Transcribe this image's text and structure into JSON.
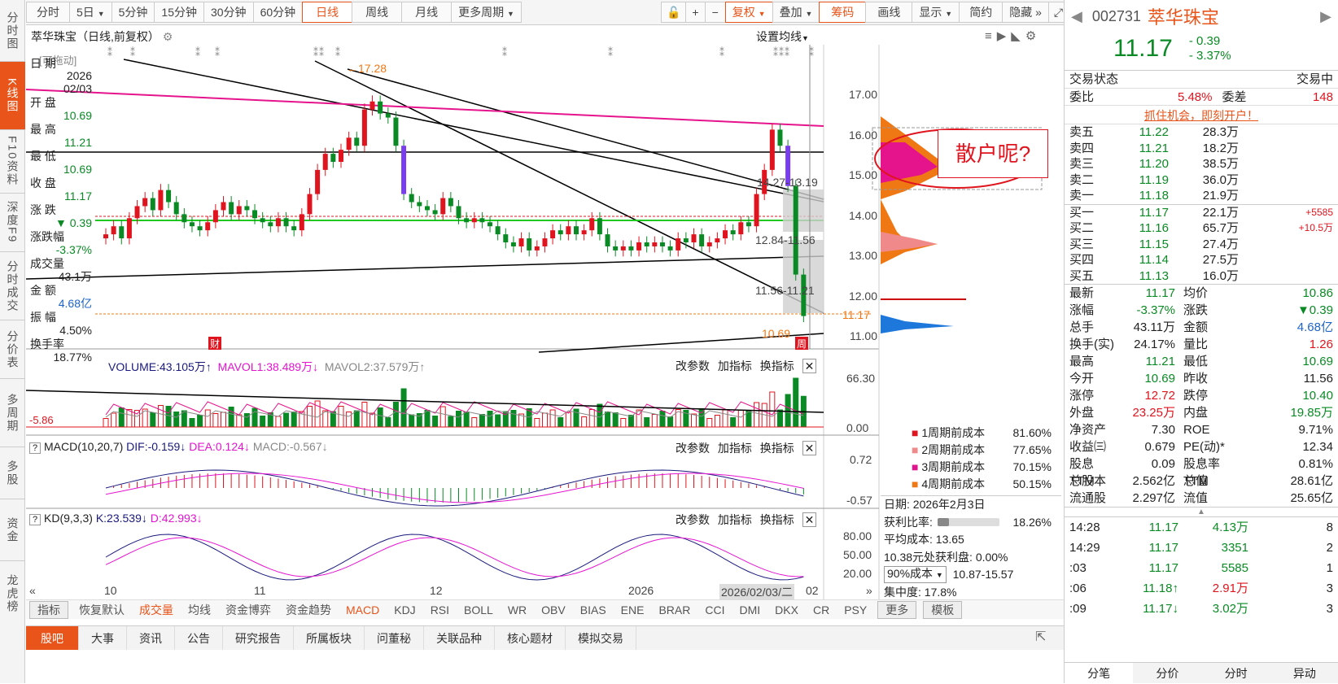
{
  "leftnav": [
    "分时图",
    "K线图",
    "F10资料",
    "深度F9",
    "分时成交",
    "分价表",
    "多周期",
    "多股",
    "资金",
    "龙虎榜"
  ],
  "toolbar": {
    "periods": [
      "分时",
      "5日",
      "5分钟",
      "15分钟",
      "30分钟",
      "60分钟",
      "日线",
      "周线",
      "月线",
      "更多周期"
    ],
    "active": "日线",
    "right": [
      "复权",
      "叠加",
      "筹码",
      "画线",
      "显示",
      "简约",
      "隐藏"
    ]
  },
  "chart_title": "萃华珠宝（日线,前复权）",
  "set_ma": "设置均线",
  "draggable": "[可拖动]",
  "info": {
    "date_label": "日 期",
    "date_year": "2026",
    "date_md": "02/03",
    "open_label": "开 盘",
    "open": "10.69",
    "high_label": "最 高",
    "high": "11.21",
    "low_label": "最 低",
    "low": "10.69",
    "close_label": "收 盘",
    "close": "11.17",
    "chg_label": "涨 跌",
    "chg": "▼ 0.39",
    "chgp_label": "涨跌幅",
    "chgp": "-3.37%",
    "vol_label": "成交量",
    "vol": "43.1万",
    "amt_label": "金 额",
    "amt": "4.68亿",
    "amp_label": "振 幅",
    "amp": "4.50%",
    "turn_label": "换手率",
    "turn": "18.77%"
  },
  "price_axis": [
    "17.00",
    "16.00",
    "15.00",
    "14.00",
    "13.00",
    "12.00",
    "11.00"
  ],
  "last_price_tag": "11.17",
  "annotations": {
    "high": "←17.28",
    "a1": "14.27-13.19",
    "a2": "12.84-11.56",
    "a3": "11.56-11.21",
    "a4": "10.69",
    "speech": "散户呢?",
    "low_tag": "-5.86"
  },
  "volume": {
    "label": "VOLUME:43.105万",
    "mavol1": "MAVOL1:38.489万",
    "mavol2": "MAVOL2:37.579万",
    "axis_top": "66.30",
    "axis_bot": "0.00"
  },
  "macd": {
    "label": "MACD(10,20,7)",
    "dif": "DIF:-0.159",
    "dea": "DEA:0.124",
    "macd": "MACD:-0.567",
    "axis_top": "0.72",
    "axis_bot": "-0.57"
  },
  "kd": {
    "label": "KD(9,3,3)",
    "k": "K:23.539",
    "d": "D:42.993",
    "axis": [
      "80.00",
      "50.00",
      "20.00"
    ]
  },
  "panel_btns": [
    "改参数",
    "加指标",
    "换指标"
  ],
  "x_axis": [
    "10",
    "11",
    "12",
    "2026"
  ],
  "x_cursor": "2026/02/03/二",
  "x_end": "02",
  "chip": {
    "legend": [
      {
        "n": "1周期前成本",
        "v": "81.60%",
        "c": "#e0141e"
      },
      {
        "n": "2周期前成本",
        "v": "77.65%",
        "c": "#f08a8a"
      },
      {
        "n": "3周期前成本",
        "v": "70.15%",
        "c": "#e0148c"
      },
      {
        "n": "4周期前成本",
        "v": "50.15%",
        "c": "#f07814"
      }
    ],
    "date": "日期: 2026年2月3日",
    "profit_label": "获利比率:",
    "profit_ratio": 0.1826,
    "profit": "18.26%",
    "avg": "平均成本: 13.65",
    "profit_at": "10.38元处获利盘: 0.00%",
    "cost_sel": "90%成本",
    "cost_range": "10.87-15.57",
    "conc": "集中度: 17.8%"
  },
  "indicators": [
    "指标",
    "恢复默认",
    "成交量",
    "均线",
    "资金博弈",
    "资金趋势",
    "MACD",
    "KDJ",
    "RSI",
    "BOLL",
    "WR",
    "OBV",
    "BIAS",
    "ENE",
    "BRAR",
    "CCI",
    "DMI",
    "DKX",
    "CR",
    "PSY",
    "更多",
    "模板"
  ],
  "bottom_tabs": [
    "股吧",
    "大事",
    "资讯",
    "公告",
    "研究报告",
    "所属板块",
    "问董秘",
    "关联品种",
    "核心题材",
    "模拟交易"
  ],
  "quote": {
    "code": "002731",
    "name": "萃华珠宝",
    "price": "11.17",
    "chg": "- 0.39",
    "chgp": "- 3.37%",
    "status_label": "交易状态",
    "status": "交易中",
    "wb_label": "委比",
    "wb": "5.48%",
    "wc_label": "委差",
    "wc": "148",
    "promo": "抓住机会，即刻开户！",
    "asks": [
      [
        "卖五",
        "11.22",
        "28.3万"
      ],
      [
        "卖四",
        "11.21",
        "18.2万"
      ],
      [
        "卖三",
        "11.20",
        "38.5万"
      ],
      [
        "卖二",
        "11.19",
        "36.0万"
      ],
      [
        "卖一",
        "11.18",
        "21.9万"
      ]
    ],
    "bids": [
      [
        "买一",
        "11.17",
        "22.1万",
        "+5585"
      ],
      [
        "买二",
        "11.16",
        "65.7万",
        "+10.5万"
      ],
      [
        "买三",
        "11.15",
        "27.4万",
        ""
      ],
      [
        "买四",
        "11.14",
        "27.5万",
        ""
      ],
      [
        "买五",
        "11.13",
        "16.0万",
        ""
      ]
    ],
    "stats": [
      [
        "最新",
        "11.17",
        "均价",
        "10.86"
      ],
      [
        "涨幅",
        "-3.37%",
        "涨跌",
        "▼0.39"
      ],
      [
        "总手",
        "43.11万",
        "金额",
        "4.68亿"
      ],
      [
        "换手(实)",
        "24.17%",
        "量比",
        "1.26"
      ],
      [
        "最高",
        "11.21",
        "最低",
        "10.69"
      ],
      [
        "今开",
        "10.69",
        "昨收",
        "11.56"
      ],
      [
        "涨停",
        "12.72",
        "跌停",
        "10.40"
      ],
      [
        "外盘",
        "23.25万",
        "内盘",
        "19.85万"
      ],
      [
        "净资产",
        "7.30",
        "ROE",
        "9.71%"
      ],
      [
        "收益㈢",
        "0.679",
        "PE(动)*",
        "12.34"
      ],
      [
        "股息TTM",
        "0.09",
        "股息率TTM",
        "0.81%"
      ],
      [
        "总股本",
        "2.562亿",
        "总值",
        "28.61亿"
      ],
      [
        "流通股",
        "2.297亿",
        "流值",
        "25.65亿"
      ]
    ],
    "ticks": [
      [
        "14:28",
        "11.17",
        "4.13万",
        "8"
      ],
      [
        "14:29",
        "11.17",
        "3351",
        "2"
      ],
      [
        ":03",
        "11.17",
        "5585",
        "1"
      ],
      [
        ":06",
        "11.18↑",
        "2.91万",
        "3"
      ],
      [
        ":09",
        "11.17↓",
        "3.02万",
        "3"
      ]
    ],
    "tabs": [
      "分笔",
      "分价",
      "分时",
      "异动"
    ]
  }
}
